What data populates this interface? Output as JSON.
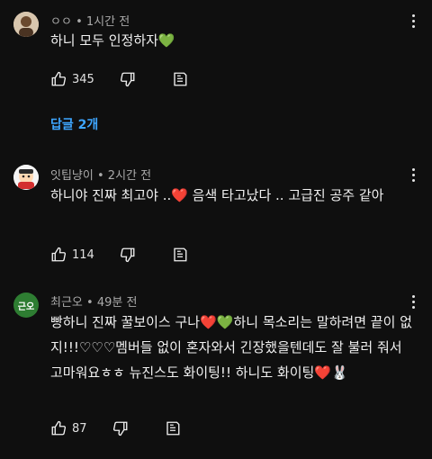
{
  "comments": [
    {
      "author": "ㅇㅇ",
      "time": "1시간 전",
      "text": "하니 모두 인정하자💚",
      "likes": "345",
      "avatar_color": "#8a6b4a"
    },
    {
      "author": "잇팁냥이",
      "time": "2시간 전",
      "text": "하니야 진짜 최고야 ..❤️ 음색 타고났다 .. 고급진 공주 같아",
      "likes": "114",
      "avatar_color": "#3b8a3a"
    },
    {
      "author": "최근오",
      "time": "49분 전",
      "text": "빵하니 진짜 꿀보이스 구나❤️💚하니 목소리는 말하려면 끝이 없지!!!♡♡♡멤버들 없이 혼자와서 긴장했을텐데도 잘 불러 줘서 고마워요ㅎㅎ 뉴진스도 화이팅!! 하니도 화이팅❤️🐰",
      "likes": "87",
      "avatar_text": "근오",
      "avatar_color": "#2e7d32"
    }
  ],
  "replies_label": "답글 2개",
  "colors": {
    "background": "#0f0f0f",
    "link": "#3ea6ff",
    "meta": "#aaaaaa"
  },
  "icons": [
    "thumbs-up-icon",
    "thumbs-down-icon",
    "reply-icon",
    "more-vert-icon"
  ]
}
